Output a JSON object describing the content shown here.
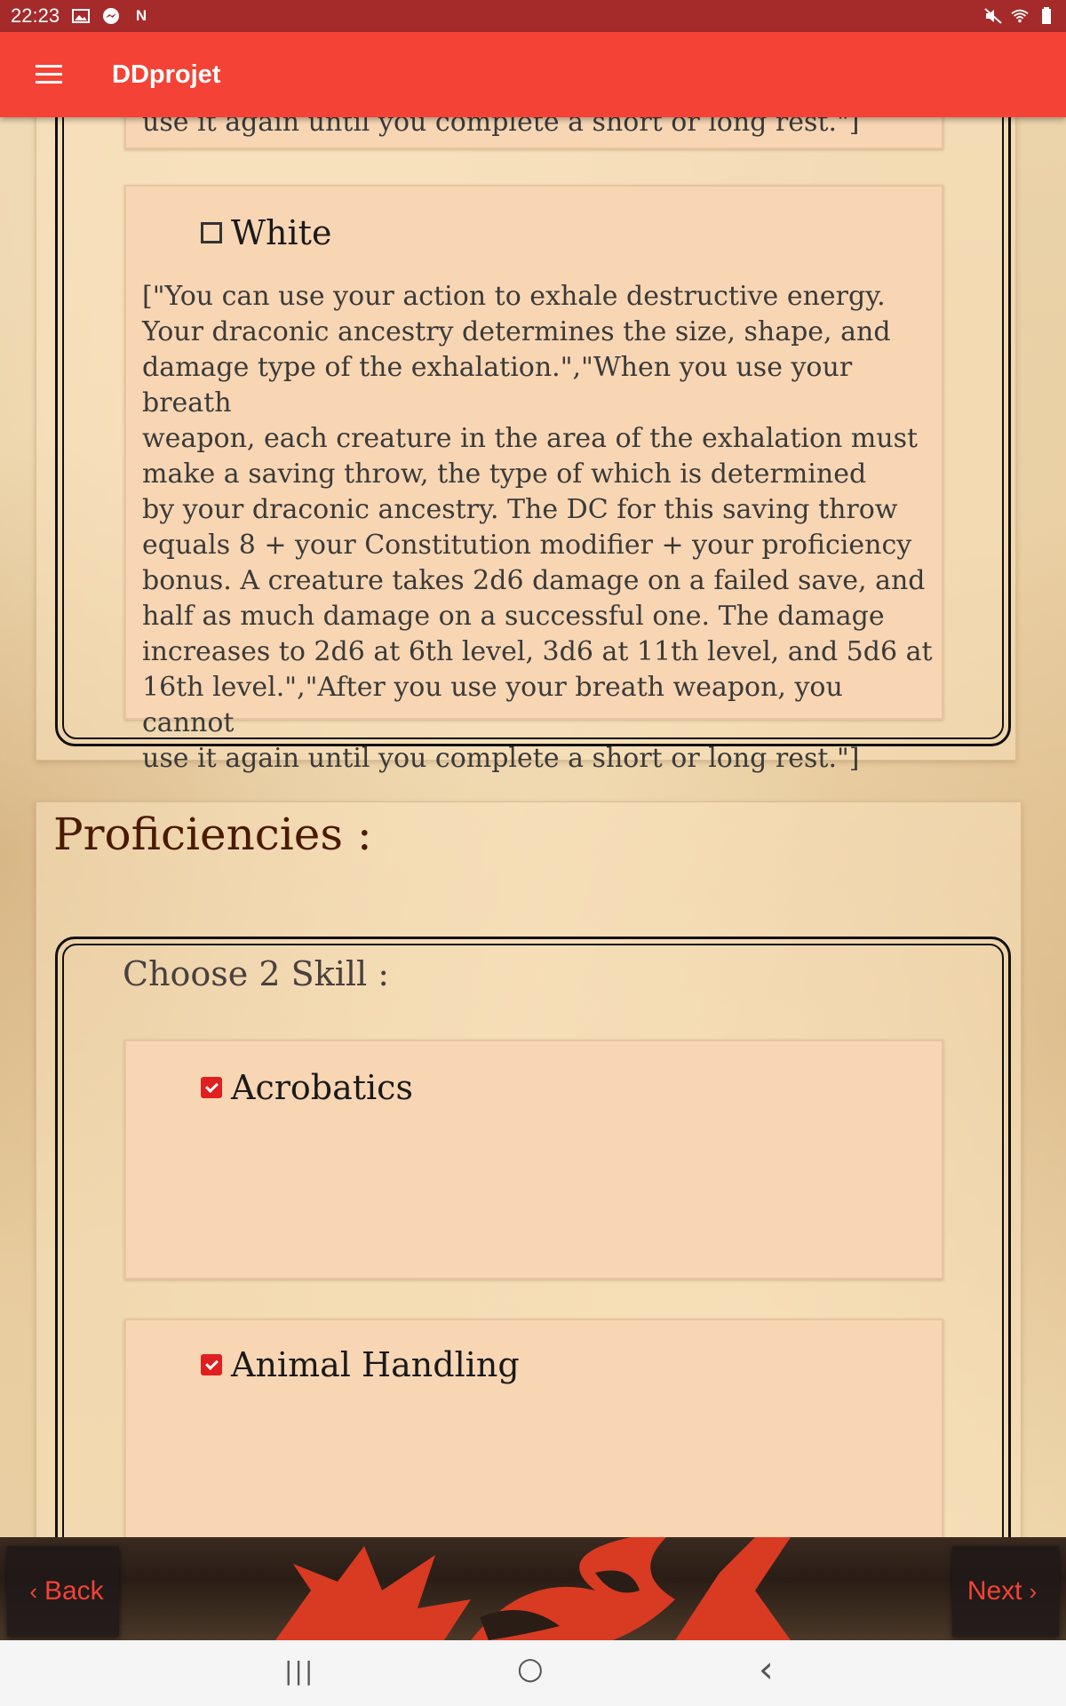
{
  "status_bar": {
    "time": "22:23",
    "left_icons": [
      "image-icon",
      "messenger-icon",
      "netflix-icon"
    ],
    "netflix_glyph": "N",
    "right_icons": [
      "mute-icon",
      "wifi-icon",
      "battery-icon"
    ]
  },
  "app_bar": {
    "title": "DDprojet",
    "color": "#f44336"
  },
  "trait_card": {
    "cut_off_text": "use it again until you complete a short or long rest.\"]"
  },
  "ancestry_option": {
    "label": "White",
    "checked": false,
    "description": "[\"You can use your action to exhale destructive energy.\nYour draconic ancestry determines the size, shape, and\ndamage type of the exhalation.\",\"When you use your breath\nweapon, each creature in the area of the exhalation must\nmake a saving throw, the type of which is determined\nby your draconic ancestry. The DC for this saving throw\nequals 8 + your Constitution modifier + your proficiency\nbonus. A creature takes 2d6 damage on a failed save, and\nhalf as much damage on a successful one. The damage\nincreases to 2d6 at 6th level, 3d6 at 11th level, and 5d6 at\n16th level.\",\"After you use your breath weapon, you cannot\nuse it again until you complete a short or long rest.\"]"
  },
  "proficiencies": {
    "title": "Proficiencies :",
    "choose_label": "Choose 2 Skill  :",
    "skills": [
      {
        "label": "Acrobatics",
        "checked": true
      },
      {
        "label": "Animal Handling",
        "checked": true
      }
    ]
  },
  "bottom_nav": {
    "back_label": "Back",
    "next_label": "Next",
    "accent": "#f44336"
  },
  "system_nav": {
    "recents_glyph": "|||",
    "home_glyph": "○",
    "back_glyph": "‹"
  }
}
